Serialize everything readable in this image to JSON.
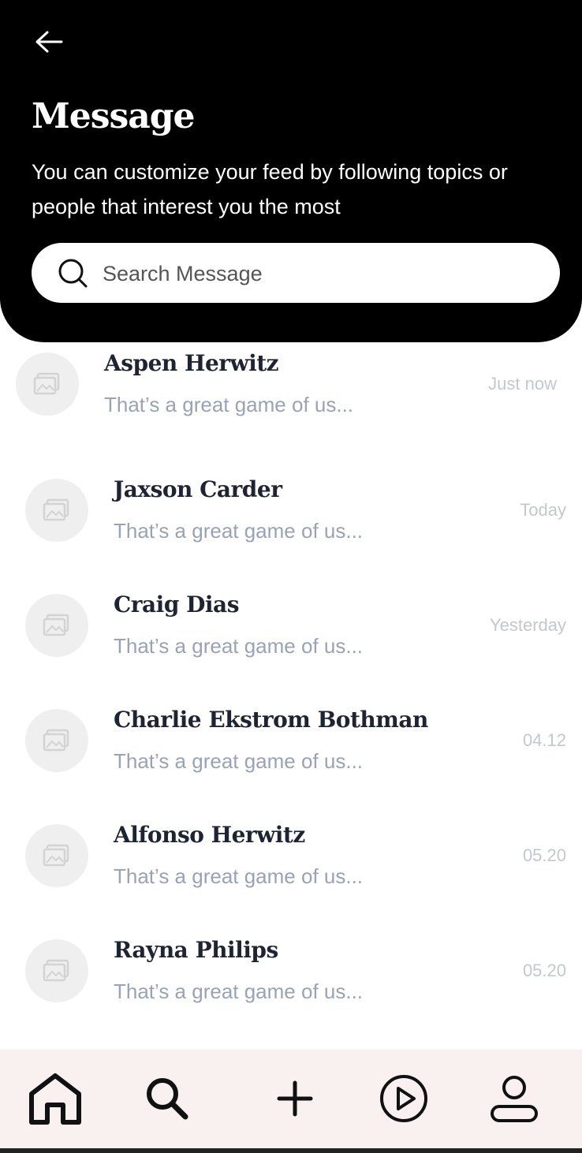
{
  "header": {
    "title": "Message",
    "subtitle": "You can customize your feed by following topics or people that interest you the most"
  },
  "search": {
    "placeholder": "Search Message",
    "value": ""
  },
  "messages": [
    {
      "name": "Aspen Herwitz",
      "preview": "That’s a great game of us...",
      "time": "Just now"
    },
    {
      "name": "Jaxson Carder",
      "preview": "That’s a great game of us...",
      "time": "Today"
    },
    {
      "name": "Craig Dias",
      "preview": "That’s a great game of us...",
      "time": "Yesterday"
    },
    {
      "name": "Charlie Ekstrom Bothman",
      "preview": "That’s a great game of us...",
      "time": "04.12"
    },
    {
      "name": "Alfonso Herwitz",
      "preview": "That’s a great game of us...",
      "time": "05.20"
    },
    {
      "name": "Rayna Philips",
      "preview": "That’s a great game of us...",
      "time": "05.20"
    }
  ],
  "nav": {
    "items": [
      "home-icon",
      "search-icon",
      "plus-icon",
      "play-icon",
      "profile-icon"
    ],
    "active": "home-icon"
  },
  "colors": {
    "header_bg": "#000000",
    "name": "#1f2433",
    "preview": "#9aa2b7",
    "time": "#c3c7d1",
    "nav_bg": "#f8f1ef"
  }
}
